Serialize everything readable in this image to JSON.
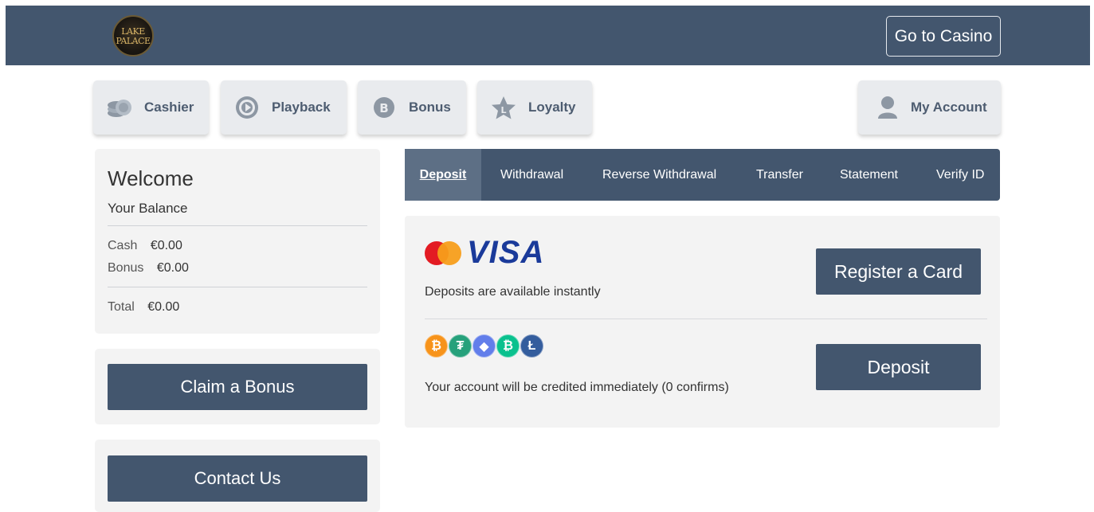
{
  "header": {
    "logo_text_line1": "LAKE",
    "logo_text_line2": "PALACE",
    "go_to_casino": "Go to Casino"
  },
  "nav": {
    "cashier": "Cashier",
    "playback": "Playback",
    "bonus": "Bonus",
    "loyalty": "Loyalty",
    "my_account": "My Account"
  },
  "balance": {
    "welcome": "Welcome",
    "your_balance": "Your Balance",
    "cash_label": "Cash",
    "cash_value": "€0.00",
    "bonus_label": "Bonus",
    "bonus_value": "€0.00",
    "total_label": "Total",
    "total_value": "€0.00"
  },
  "side_buttons": {
    "claim_bonus": "Claim a Bonus",
    "contact_us": "Contact Us"
  },
  "tabs": [
    "Deposit",
    "Withdrawal",
    "Reverse Withdrawal",
    "Transfer",
    "Statement",
    "Verify ID"
  ],
  "active_tab": "Deposit",
  "card_method": {
    "brand_text": "VISA",
    "description": "Deposits are available instantly",
    "button": "Register a Card"
  },
  "crypto_method": {
    "coins": [
      {
        "symbol": "₿",
        "icon": "bitcoin-icon",
        "color": "#f7931a"
      },
      {
        "symbol": "₮",
        "icon": "tether-icon",
        "color": "#26a17b"
      },
      {
        "symbol": "◆",
        "icon": "ethereum-icon",
        "color": "#627eea"
      },
      {
        "symbol": "₿",
        "icon": "bitcoin-cash-icon",
        "color": "#0ac18e"
      },
      {
        "symbol": "Ł",
        "icon": "litecoin-icon",
        "color": "#345d9d"
      }
    ],
    "description": "Your account will be credited immediately (0 confirms)",
    "button": "Deposit"
  },
  "colors": {
    "brand_navy": "#43566e",
    "active_tab": "#5d6f85",
    "panel_bg": "#f3f3f3",
    "mastercard_red": "#e31b23",
    "mastercard_orange": "#f79e1b",
    "visa_blue": "#1a3a9a"
  }
}
